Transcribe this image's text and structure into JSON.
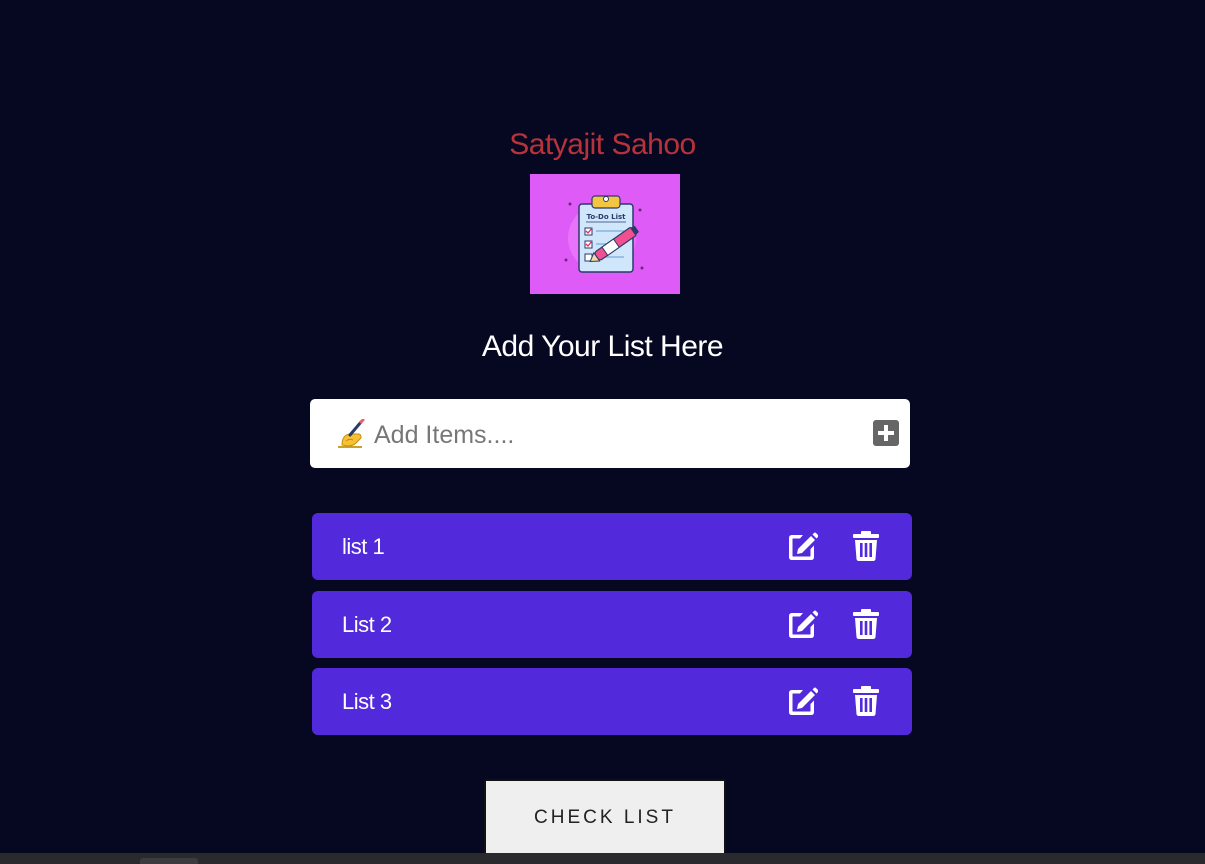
{
  "header": {
    "author": "Satyajit Sahoo",
    "logo_text": "To-Do List"
  },
  "main": {
    "title": "Add Your List Here",
    "input": {
      "placeholder": "Add Items....",
      "value": "",
      "emoji_icon": "writing-hand-icon",
      "add_icon": "plus-square-icon"
    },
    "items": [
      {
        "label": "list 1"
      },
      {
        "label": "List 2"
      },
      {
        "label": "List 3"
      }
    ],
    "check_button_label": "CHECK LIST"
  },
  "colors": {
    "background": "#060822",
    "author": "#b8323a",
    "logo_bg": "#df5bf7",
    "item_bg": "#5229db",
    "add_button": "#666666"
  }
}
